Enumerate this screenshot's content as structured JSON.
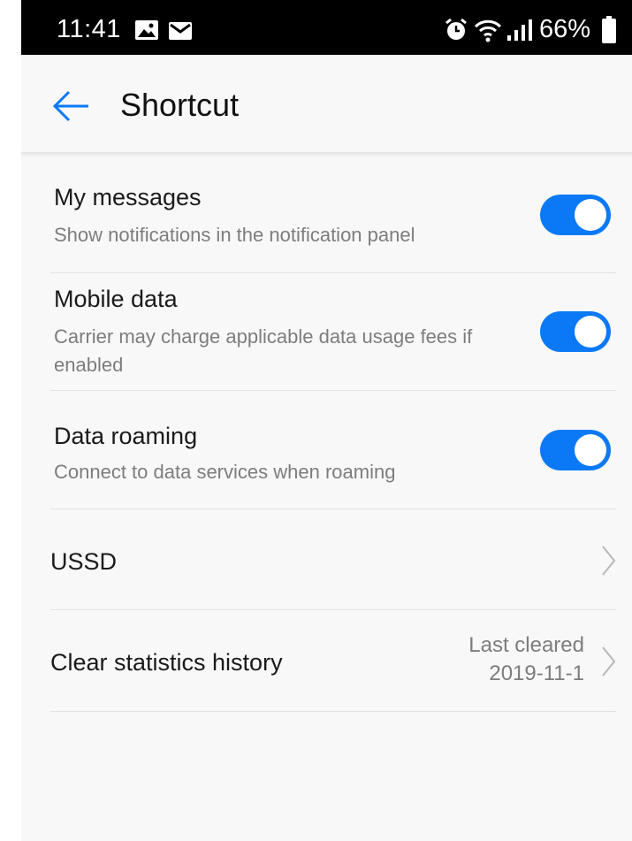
{
  "status_bar": {
    "time": "11:41",
    "battery": "66%",
    "icons": [
      "image-icon",
      "mail-icon",
      "alarm-icon",
      "wifi-icon",
      "signal-icon",
      "battery-icon"
    ]
  },
  "header": {
    "title": "Shortcut",
    "back_icon": "back-arrow-icon"
  },
  "settings": [
    {
      "title": "My messages",
      "subtitle": "Show notifications in the notification panel",
      "toggle_on": true
    },
    {
      "title": "Mobile data",
      "subtitle": "Carrier may charge applicable data usage fees if enabled",
      "toggle_on": true
    },
    {
      "title": "Data roaming",
      "subtitle": "Connect to data services when roaming",
      "toggle_on": true
    }
  ],
  "ussd": {
    "title": "USSD"
  },
  "clear_history": {
    "title": "Clear statistics history",
    "value_line1": "Last cleared",
    "value_line2": "2019-11-1"
  },
  "colors": {
    "accent": "#0b79f5",
    "background": "#f8f8f8",
    "status_bar": "#000000"
  }
}
